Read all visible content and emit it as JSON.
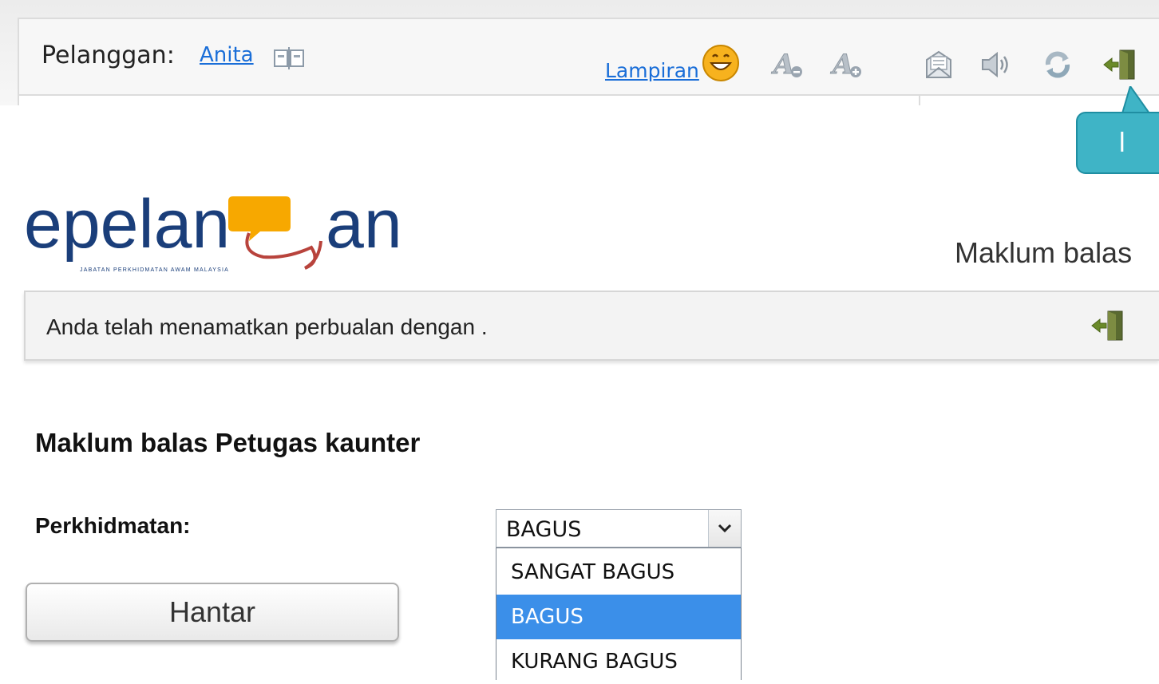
{
  "toolbar": {
    "customer_label": "Pelanggan:",
    "customer_name": "Anita",
    "attachment_label": "Lampiran",
    "icons": [
      "transfer-icon",
      "smiley-icon",
      "font-decrease-icon",
      "font-increase-icon",
      "email-transcript-icon",
      "sound-icon",
      "refresh-icon",
      "exit-icon"
    ]
  },
  "callout": {
    "text": "l",
    "color": "#3fb4c6"
  },
  "header": {
    "logo_text_left": "epelan",
    "logo_text_right": "an",
    "logo_tagline": "JABATAN PERKHIDMATAN AWAM MALAYSIA",
    "title": "Maklum balas",
    "brand_color": "#f7a800",
    "logo_color": "#1a3e7a"
  },
  "notice": {
    "text": "Anda telah menamatkan perbualan dengan ."
  },
  "form": {
    "title": "Maklum balas Petugas kaunter",
    "field_label": "Perkhidmatan:",
    "selected_value": "BAGUS",
    "options": [
      "SANGAT BAGUS",
      "BAGUS",
      "KURANG BAGUS"
    ],
    "highlighted_option": "BAGUS",
    "submit_label": "Hantar",
    "highlight_color": "#3b8fe9"
  }
}
